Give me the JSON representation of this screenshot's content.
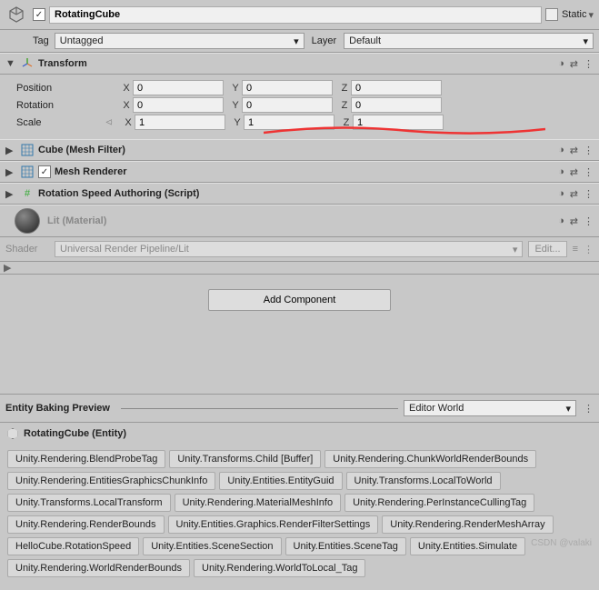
{
  "header": {
    "name": "RotatingCube",
    "static_label": "Static",
    "tag_label": "Tag",
    "tag_value": "Untagged",
    "layer_label": "Layer",
    "layer_value": "Default"
  },
  "transform": {
    "title": "Transform",
    "position": {
      "label": "Position",
      "x": "0",
      "y": "0",
      "z": "0"
    },
    "rotation": {
      "label": "Rotation",
      "x": "0",
      "y": "0",
      "z": "0"
    },
    "scale": {
      "label": "Scale",
      "x": "1",
      "y": "1",
      "z": "1"
    }
  },
  "components": {
    "mesh_filter": "Cube (Mesh Filter)",
    "mesh_renderer": "Mesh Renderer",
    "rotation_script": "Rotation Speed Authoring (Script)"
  },
  "material": {
    "title": "Lit (Material)",
    "shader_label": "Shader",
    "shader_value": "Universal Render Pipeline/Lit",
    "edit": "Edit..."
  },
  "add_component": "Add Component",
  "baking": {
    "title": "Entity Baking Preview",
    "world": "Editor World",
    "entity_name": "RotatingCube (Entity)",
    "tags": [
      "Unity.Rendering.BlendProbeTag",
      "Unity.Transforms.Child [Buffer]",
      "Unity.Rendering.ChunkWorldRenderBounds",
      "Unity.Rendering.EntitiesGraphicsChunkInfo",
      "Unity.Entities.EntityGuid",
      "Unity.Transforms.LocalToWorld",
      "Unity.Transforms.LocalTransform",
      "Unity.Rendering.MaterialMeshInfo",
      "Unity.Rendering.PerInstanceCullingTag",
      "Unity.Rendering.RenderBounds",
      "Unity.Entities.Graphics.RenderFilterSettings",
      "Unity.Rendering.RenderMeshArray",
      "HelloCube.RotationSpeed",
      "Unity.Entities.SceneSection",
      "Unity.Entities.SceneTag",
      "Unity.Entities.Simulate",
      "Unity.Rendering.WorldRenderBounds",
      "Unity.Rendering.WorldToLocal_Tag"
    ]
  },
  "watermark": "CSDN @valaki"
}
